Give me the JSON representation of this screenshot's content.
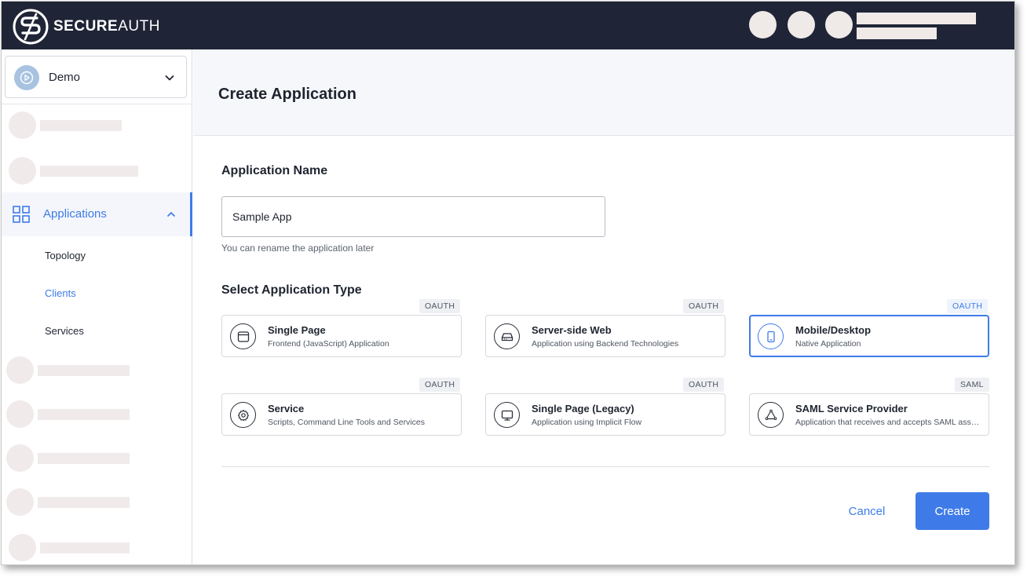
{
  "brand": {
    "name_bold": "SECURE",
    "name_light": "AUTH"
  },
  "tenant": {
    "name": "Demo"
  },
  "sidebar": {
    "active_item": {
      "label": "Applications"
    },
    "subitems": [
      {
        "label": "Topology"
      },
      {
        "label": "Clients"
      },
      {
        "label": "Services"
      }
    ]
  },
  "page": {
    "title": "Create Application",
    "name_section": "Application Name",
    "name_value": "Sample App",
    "name_helper": "You can rename the application later",
    "type_section": "Select Application Type"
  },
  "app_types": [
    {
      "title": "Single Page",
      "subtitle": "Frontend (JavaScript) Application",
      "badge": "OAUTH",
      "icon": "browser-window-icon",
      "selected": false
    },
    {
      "title": "Server-side Web",
      "subtitle": "Application using Backend Technologies",
      "badge": "OAUTH",
      "icon": "server-drive-icon",
      "selected": false
    },
    {
      "title": "Mobile/Desktop",
      "subtitle": "Native Application",
      "badge": "OAUTH",
      "icon": "mobile-phone-icon",
      "selected": true
    },
    {
      "title": "Service",
      "subtitle": "Scripts, Command Line Tools and Services",
      "badge": "OAUTH",
      "icon": "gear-icon",
      "selected": false
    },
    {
      "title": "Single Page (Legacy)",
      "subtitle": "Application using Implicit Flow",
      "badge": "OAUTH",
      "icon": "monitor-icon",
      "selected": false
    },
    {
      "title": "SAML Service Provider",
      "subtitle": "Application that receives and accepts SAML assertions",
      "badge": "SAML",
      "icon": "triangle-cycle-icon",
      "selected": false
    }
  ],
  "actions": {
    "cancel": "Cancel",
    "create": "Create"
  },
  "colors": {
    "accent": "#3f7be8",
    "topbar": "#1f2536",
    "placeholder": "#f0eaea"
  }
}
